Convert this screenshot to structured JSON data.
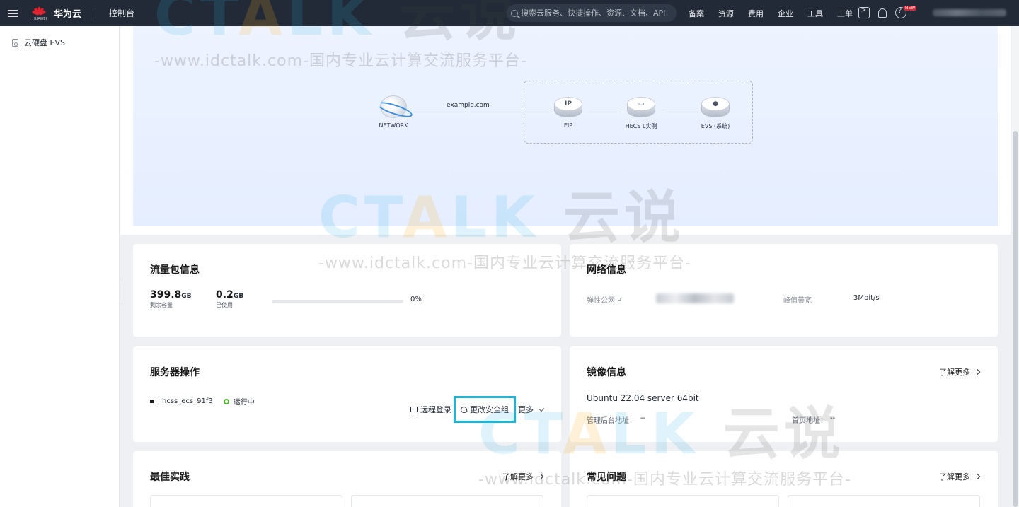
{
  "topbar": {
    "brand": "华为云",
    "logo_sub": "HUAWEI",
    "console": "控制台",
    "search_placeholder": "搜索云服务、快捷操作、资源、文档、API",
    "links": [
      "备案",
      "资源",
      "费用",
      "企业",
      "工具",
      "工单"
    ],
    "new_badge": "NEW"
  },
  "sidebar": {
    "items": [
      {
        "label": "云硬盘 EVS",
        "icon": "disk-icon"
      }
    ]
  },
  "topology": {
    "nodes": {
      "network": "NETWORK",
      "eip": "EIP",
      "ecs": "HECS L实例",
      "evs": "EVS (系统)"
    },
    "link_label": "example.com",
    "eip_glyph": "IP"
  },
  "traffic": {
    "title": "流量包信息",
    "remaining_value": "399.8",
    "remaining_unit": "GB",
    "remaining_label": "剩余容量",
    "used_value": "0.2",
    "used_unit": "GB",
    "used_label": "已使用",
    "percent": "0%",
    "percent_value": 0
  },
  "network": {
    "title": "网络信息",
    "eip_label": "弹性公网IP",
    "bandwidth_label": "峰值带宽",
    "bandwidth_value": "3Mbit/s"
  },
  "server_ops": {
    "title": "服务器操作",
    "server_name": "hcss_ecs_91f3",
    "status": "运行中",
    "remote_login": "远程登录",
    "change_sg": "更改安全组",
    "more": "更多"
  },
  "image": {
    "title": "镜像信息",
    "more": "了解更多",
    "os": "Ubuntu 22.04 server 64bit",
    "admin_label": "管理后台地址：",
    "admin_value": "--",
    "home_label": "首页地址：",
    "home_value": "--"
  },
  "best_practice": {
    "title": "最佳实践",
    "more": "了解更多"
  },
  "faq": {
    "title": "常见问题",
    "more": "了解更多"
  },
  "watermark": {
    "brand_c": "C",
    "brand_t": "T",
    "brand_a": "A",
    "brand_lk": "LK",
    "brand_cn": "云说",
    "url": "-www.idctalk.com-国内专业云计算交流服务平台-"
  },
  "colors": {
    "topbar": "#212a36",
    "accent": "#526ecc",
    "highlight": "#1fb3d6",
    "status_ok": "#50b82e"
  }
}
